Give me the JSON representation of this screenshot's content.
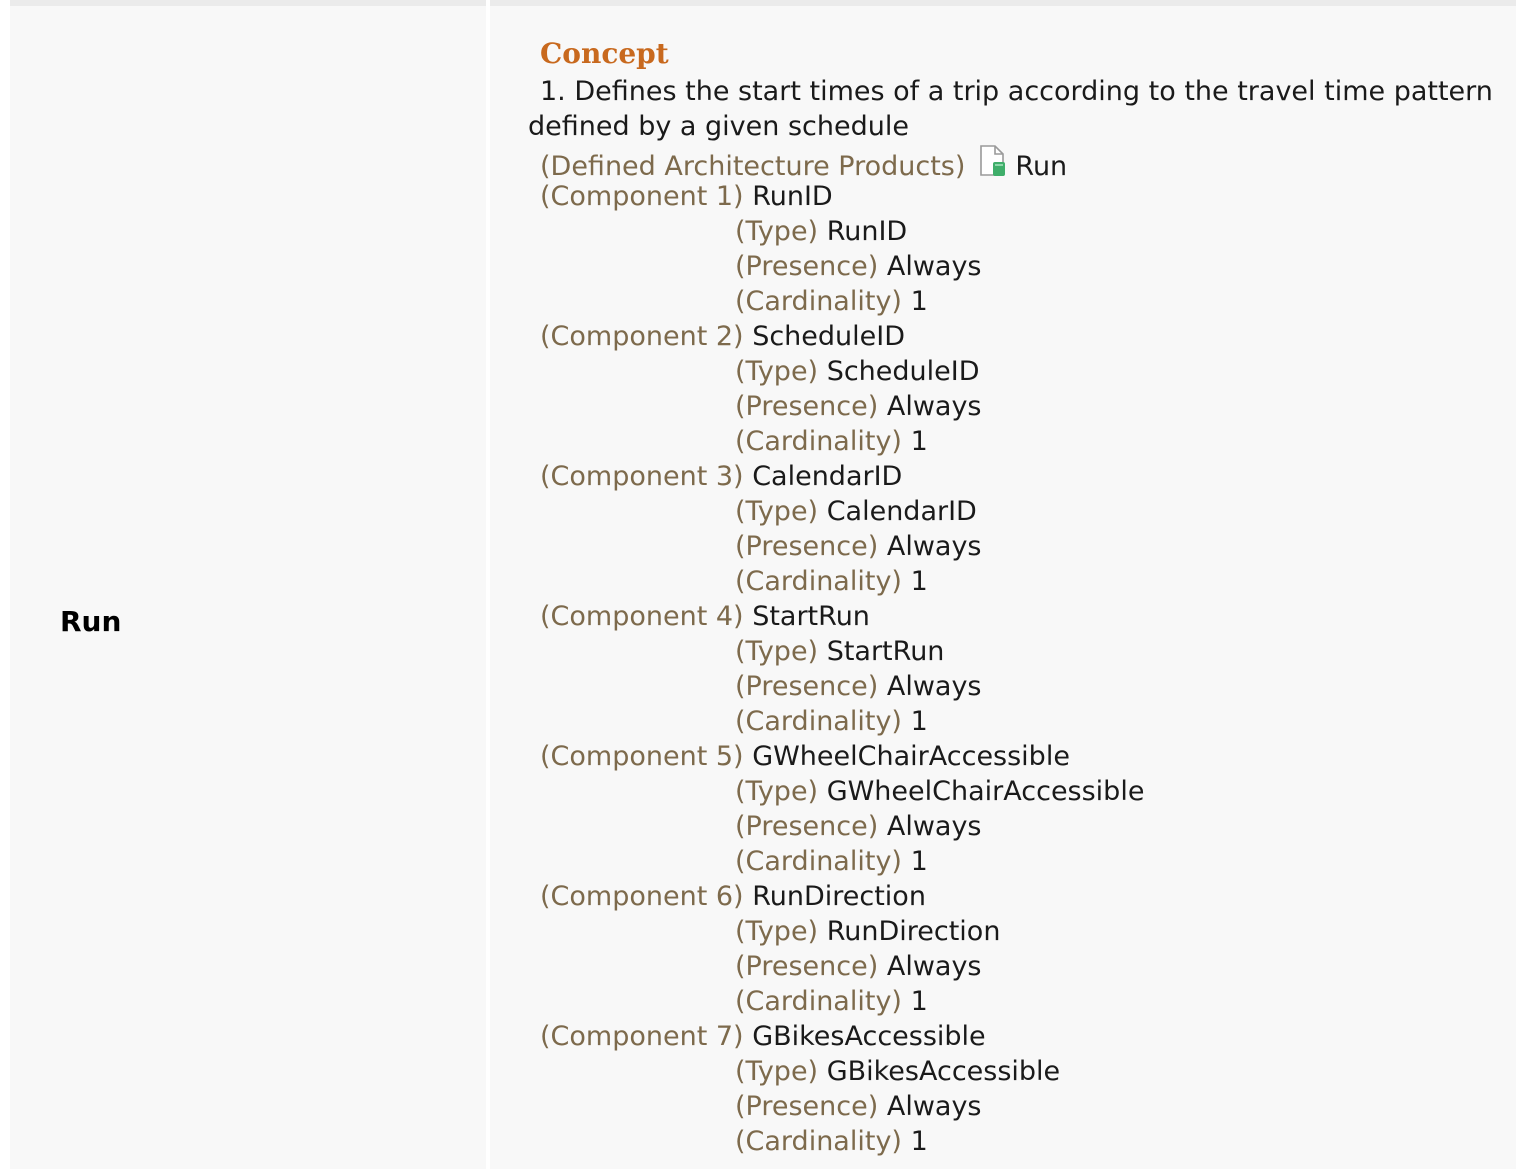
{
  "row": {
    "term": "Run"
  },
  "concept": {
    "heading": "Concept",
    "definition": "1. Defines the start times of a trip according to the travel time pattern defined by a given schedule",
    "products_label": "(Defined Architecture Products)",
    "products_icon": "document-icon",
    "products_value": "Run"
  },
  "labels": {
    "type": "(Type)",
    "presence": "(Presence)",
    "cardinality": "(Cardinality)"
  },
  "components": [
    {
      "label": "(Component 1)",
      "name": "RunID",
      "type": "RunID",
      "presence": "Always",
      "cardinality": "1"
    },
    {
      "label": "(Component 2)",
      "name": "ScheduleID",
      "type": "ScheduleID",
      "presence": "Always",
      "cardinality": "1"
    },
    {
      "label": "(Component 3)",
      "name": "CalendarID",
      "type": "CalendarID",
      "presence": "Always",
      "cardinality": "1"
    },
    {
      "label": "(Component 4)",
      "name": "StartRun",
      "type": "StartRun",
      "presence": "Always",
      "cardinality": "1"
    },
    {
      "label": "(Component 5)",
      "name": "GWheelChairAccessible",
      "type": "GWheelChairAccessible",
      "presence": "Always",
      "cardinality": "1"
    },
    {
      "label": "(Component 6)",
      "name": "RunDirection",
      "type": "RunDirection",
      "presence": "Always",
      "cardinality": "1"
    },
    {
      "label": "(Component 7)",
      "name": "GBikesAccessible",
      "type": "GBikesAccessible",
      "presence": "Always",
      "cardinality": "1"
    }
  ],
  "colors": {
    "heading": "#c8691e",
    "label": "#7d6a4c",
    "value": "#1a1a1a",
    "icon_accent": "#3fae6a"
  }
}
